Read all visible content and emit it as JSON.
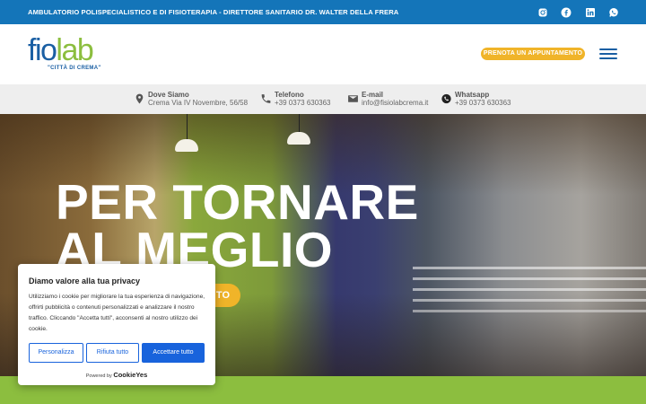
{
  "topbar": {
    "text": "AMBULATORIO POLISPECIALISTICO E DI FISIOTERAPIA - DIRETTORE SANITARIO DR. WALTER DELLA FRERA",
    "background": "#1475b9",
    "social_icons": [
      "instagram-icon",
      "facebook-icon",
      "linkedin-icon",
      "whatsapp-icon"
    ]
  },
  "header": {
    "logo": {
      "part1": "fi",
      "part2": "o",
      "part3": "lab",
      "subtitle": "\"CITTÀ DI CREMA\""
    },
    "book_button": "PRENOTA UN APPUNTAMENTO",
    "accent": "#f0b429",
    "brand_blue": "#1a5fa3",
    "brand_green": "#8cbe3f"
  },
  "info": [
    {
      "icon": "location-pin-icon",
      "label": "Dove Siamo",
      "value": "Crema Via IV Novembre, 56/58"
    },
    {
      "icon": "phone-icon",
      "label": "Telefono",
      "value": "+39 0373 630363"
    },
    {
      "icon": "mail-icon",
      "label": "E-mail",
      "value": "info@fisiolabcrema.it"
    },
    {
      "icon": "whatsapp-icon",
      "label": "Whatsapp",
      "value": "+39 0373 630363"
    }
  ],
  "hero": {
    "title_line1": "PER TORNARE",
    "title_line2": "AL MEGLIO",
    "button_visible_text": "TO"
  },
  "cookie": {
    "title": "Diamo valore alla tua privacy",
    "body": "Utilizziamo i cookie per migliorare la tua esperienza di navigazione, offrirti pubblicità o contenuti personalizzati e analizzare il nostro traffico. Cliccando \"Accetta tutti\", acconsenti al nostro utilizzo dei cookie.",
    "customize": "Personalizza",
    "reject": "Rifiuta tutto",
    "accept": "Accettare tutto",
    "powered_by": "Powered by",
    "brand": "CookieYes",
    "button_color": "#1863dc"
  }
}
